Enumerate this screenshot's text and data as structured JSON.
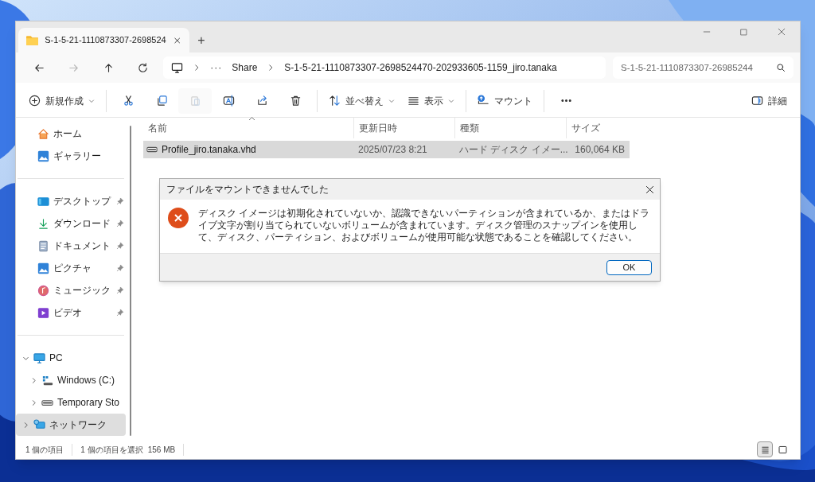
{
  "window": {
    "tab_title": "S-1-5-21-1110873307-2698524",
    "new_tab": "+"
  },
  "nav_buttons": [
    {
      "kind": "back",
      "disabled": false
    },
    {
      "kind": "forward",
      "disabled": true
    },
    {
      "kind": "up",
      "disabled": false
    },
    {
      "kind": "refresh",
      "disabled": false
    }
  ],
  "address_bar": {
    "overflow": "···",
    "crumbs": [
      "Share",
      "S-1-5-21-1110873307-2698524470-202933605-1159_jiro.tanaka"
    ]
  },
  "search": {
    "placeholder": "S-1-5-21-1110873307-26985244"
  },
  "toolbar": [
    {
      "kind": "new",
      "label": "新規作成",
      "dropdown": true,
      "disabled": false
    },
    {
      "kind": "separator"
    },
    {
      "kind": "cut",
      "disabled": false
    },
    {
      "kind": "copy",
      "disabled": false
    },
    {
      "kind": "paste",
      "disabled": true
    },
    {
      "kind": "rename",
      "disabled": false
    },
    {
      "kind": "share",
      "disabled": false
    },
    {
      "kind": "delete",
      "disabled": false
    },
    {
      "kind": "separator"
    },
    {
      "kind": "sort",
      "label": "並べ替え",
      "dropdown": true,
      "disabled": false
    },
    {
      "kind": "view",
      "label": "表示",
      "dropdown": true,
      "disabled": false
    },
    {
      "kind": "separator"
    },
    {
      "kind": "mount",
      "label": "マウント",
      "dropdown": false,
      "disabled": false
    },
    {
      "kind": "separator"
    },
    {
      "kind": "more",
      "disabled": false
    },
    {
      "kind": "details",
      "label": "詳細",
      "dropdown": false,
      "disabled": false
    }
  ],
  "sidebar": {
    "groups": [
      [
        {
          "label": "ホーム",
          "selected": false
        },
        {
          "label": "ギャラリー",
          "selected": false
        }
      ],
      [
        {
          "label": "デスクトップ",
          "pinned": true,
          "selected": false
        },
        {
          "label": "ダウンロード",
          "pinned": true,
          "selected": false
        },
        {
          "label": "ドキュメント",
          "pinned": true,
          "selected": false
        },
        {
          "label": "ピクチャ",
          "pinned": true,
          "selected": false
        },
        {
          "label": "ミュージック",
          "pinned": true,
          "selected": false
        },
        {
          "label": "ビデオ",
          "pinned": true,
          "selected": false
        }
      ],
      [
        {
          "label": "PC",
          "expanded": true,
          "selected": false,
          "children": [
            {
              "label": "Windows (C:)",
              "expanded": false,
              "selected": false
            },
            {
              "label": "Temporary Sto",
              "expanded": false,
              "selected": false
            }
          ]
        },
        {
          "label": "ネットワーク",
          "expanded": false,
          "selected": true
        }
      ]
    ]
  },
  "file_list": {
    "columns": [
      {
        "label": "名前",
        "sorted": true
      },
      {
        "label": "更新日時",
        "sorted": false
      },
      {
        "label": "種類",
        "sorted": false
      },
      {
        "label": "サイズ",
        "sorted": false
      }
    ],
    "rows": [
      {
        "name": "Profile_jiro.tanaka.vhd",
        "modified": "2025/07/23 8:21",
        "type": "ハード ディスク イメー...",
        "size": "160,064 KB",
        "selected": true
      }
    ]
  },
  "status_bar": {
    "item_count": "1 個の項目",
    "selection": "1 個の項目を選択",
    "selection_size": "156 MB",
    "view_modes": [
      {
        "kind": "details",
        "selected": true
      },
      {
        "kind": "tiles",
        "selected": false
      }
    ]
  },
  "dialog": {
    "title": "ファイルをマウントできませんでした",
    "message": "ディスク イメージは初期化されていないか、認識できないパーティションが含まれているか、またはドライブ文字が割り当てられていないボリュームが含まれています。ディスク管理のスナップインを使用して、ディスク、パーティション、およびボリュームが使用可能な状態であることを確認してください。",
    "buttons": [
      "OK"
    ]
  }
}
